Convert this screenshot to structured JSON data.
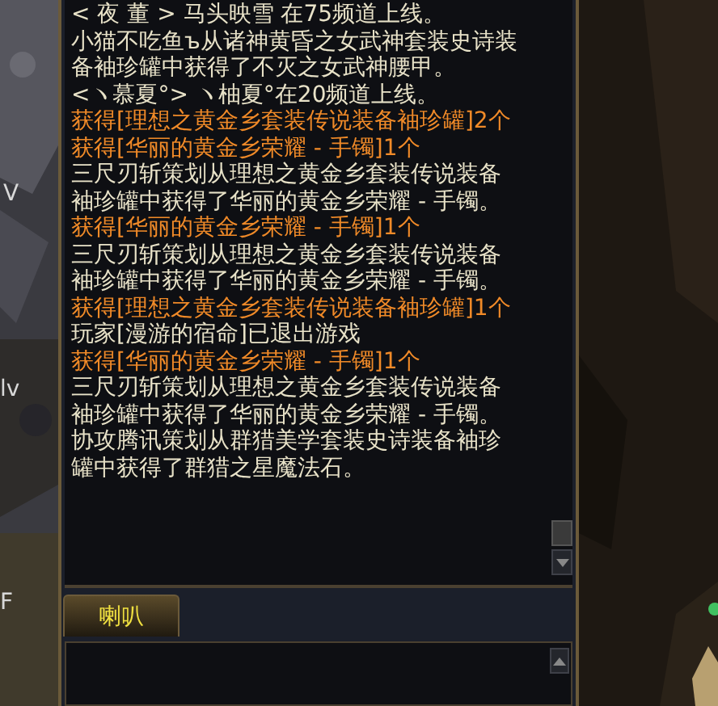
{
  "backdrop_texts": [
    "V",
    "lv",
    "F"
  ],
  "chat_log": {
    "messages": [
      {
        "kind": "system",
        "text": "< 夜 董 >  马头映雪 在75频道上线。"
      },
      {
        "kind": "system",
        "text": "小猫不吃鱼ъ从诸神黄昏之女武神套装史诗装备袖珍罐中获得了不灭之女武神腰甲。"
      },
      {
        "kind": "system",
        "text": "<ヽ慕夏°> ヽ柚夏°在20频道上线。"
      },
      {
        "kind": "loot",
        "text": "获得[理想之黄金乡套装传说装备袖珍罐]2个"
      },
      {
        "kind": "loot",
        "text": "获得[华丽的黄金乡荣耀 - 手镯]1个"
      },
      {
        "kind": "system",
        "text": "三尺刃斩策划从理想之黄金乡套装传说装备袖珍罐中获得了华丽的黄金乡荣耀 - 手镯。"
      },
      {
        "kind": "loot",
        "text": "获得[华丽的黄金乡荣耀 - 手镯]1个"
      },
      {
        "kind": "system",
        "text": "三尺刃斩策划从理想之黄金乡套装传说装备袖珍罐中获得了华丽的黄金乡荣耀 - 手镯。"
      },
      {
        "kind": "loot",
        "text": "获得[理想之黄金乡套装传说装备袖珍罐]1个"
      },
      {
        "kind": "system",
        "text": "玩家[漫游的宿命]已退出游戏"
      },
      {
        "kind": "loot",
        "text": "获得[华丽的黄金乡荣耀 - 手镯]1个"
      },
      {
        "kind": "system",
        "text": "三尺刃斩策划从理想之黄金乡套装传说装备袖珍罐中获得了华丽的黄金乡荣耀 - 手镯。"
      },
      {
        "kind": "system",
        "text": "协攻腾讯策划从群猎美学套装史诗装备袖珍罐中获得了群猎之星魔法石。"
      }
    ]
  },
  "tabs": [
    {
      "label": "喇叭",
      "selected": true
    }
  ]
}
